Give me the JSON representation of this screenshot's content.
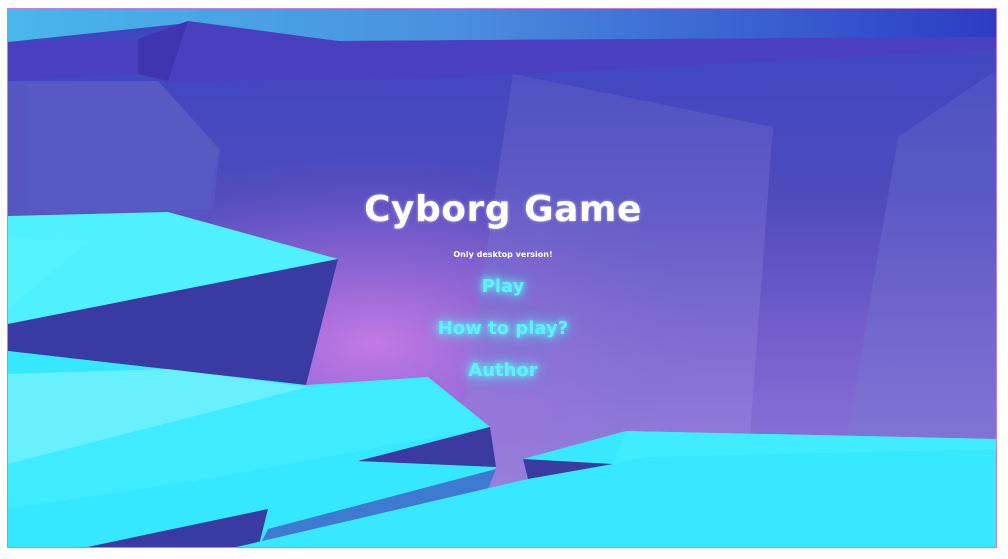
{
  "game": {
    "title": "Cyborg Game",
    "subtitle": "Only desktop version!"
  },
  "menu": {
    "items": [
      {
        "label": "Play"
      },
      {
        "label": "How to play?"
      },
      {
        "label": "Author"
      }
    ]
  },
  "colors": {
    "sky_top": "#2f4bc9",
    "sky_mid": "#4f4aba",
    "glow_purple": "#b46fe0",
    "platform_cyan": "#38e6ff",
    "platform_shadow": "#3b3aa0",
    "menu_glow": "#5ef2ff",
    "title": "#ffffff"
  }
}
